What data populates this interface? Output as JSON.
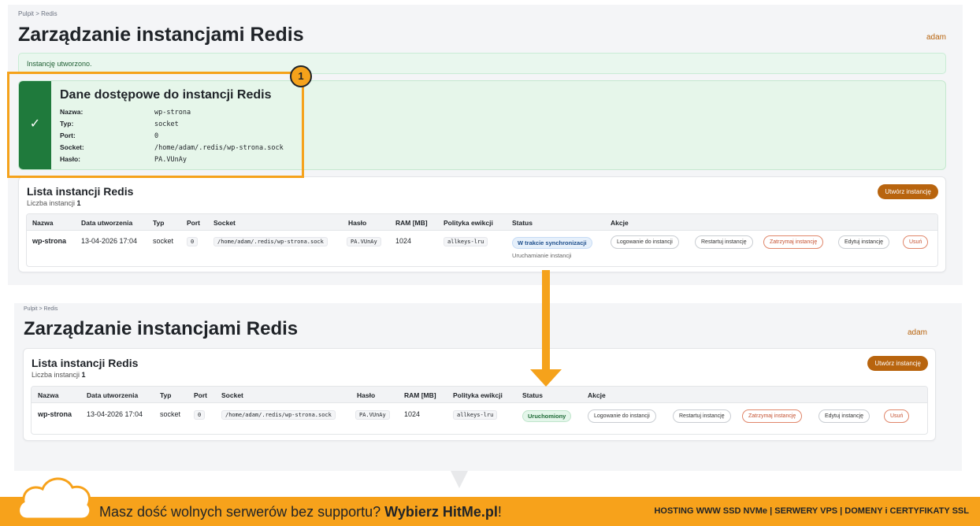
{
  "top": {
    "breadcrumb": "Pulpit  >  Redis",
    "title": "Zarządzanie instancjami Redis",
    "user": "adam",
    "alert": "Instancję utworzono.",
    "credentials": {
      "check": "✓",
      "title": "Dane dostępowe do instancji Redis",
      "rows": [
        {
          "key": "Nazwa:",
          "value": "wp-strona"
        },
        {
          "key": "Typ:",
          "value": "socket"
        },
        {
          "key": "Port:",
          "value": "0"
        },
        {
          "key": "Socket:",
          "value": "/home/adam/.redis/wp-strona.sock"
        },
        {
          "key": "Hasło:",
          "value": "PA.VUnAy"
        }
      ]
    },
    "badge": "1"
  },
  "list": {
    "title": "Lista instancji Redis",
    "count_label": "Liczba instancji",
    "count": "1",
    "create_button": "Utwórz instancję",
    "columns": [
      "Nazwa",
      "Data utworzenia",
      "Typ",
      "Port",
      "Socket",
      "Hasło",
      "RAM [MB]",
      "Polityka ewikcji",
      "Status",
      "Akcje"
    ],
    "row": {
      "name": "wp-strona",
      "date": "13-04-2026 17:04",
      "type": "socket",
      "port": "0",
      "socket": "/home/adam/.redis/wp-strona.sock",
      "password": "PA.VUnAy",
      "ram": "1024",
      "policy": "allkeys-lru"
    },
    "status_before": "W trakcie synchronizacji",
    "status_before_sub": "Uruchamianie instancji",
    "status_after": "Uruchomiony",
    "actions": [
      "Logowanie do instancji",
      "Restartuj instancję",
      "Zatrzymaj instancję",
      "Edytuj instancję",
      "Usuń"
    ]
  },
  "bottom": {
    "breadcrumb": "Pulpit  >  Redis",
    "title": "Zarządzanie instancjami Redis",
    "user": "adam"
  },
  "banner": {
    "slogan_prefix": "Masz dość wolnych serwerów bez supportu? ",
    "slogan_bold": "Wybierz HitMe.pl",
    "slogan_suffix": "!",
    "tagline": "HOSTING WWW SSD NVMe | SERWERY VPS | DOMENY i CERTYFIKATY SSL"
  },
  "colors": {
    "accent_orange": "#f5a21b",
    "brand_brown": "#b8640e",
    "success_green": "#1f7a3c"
  }
}
